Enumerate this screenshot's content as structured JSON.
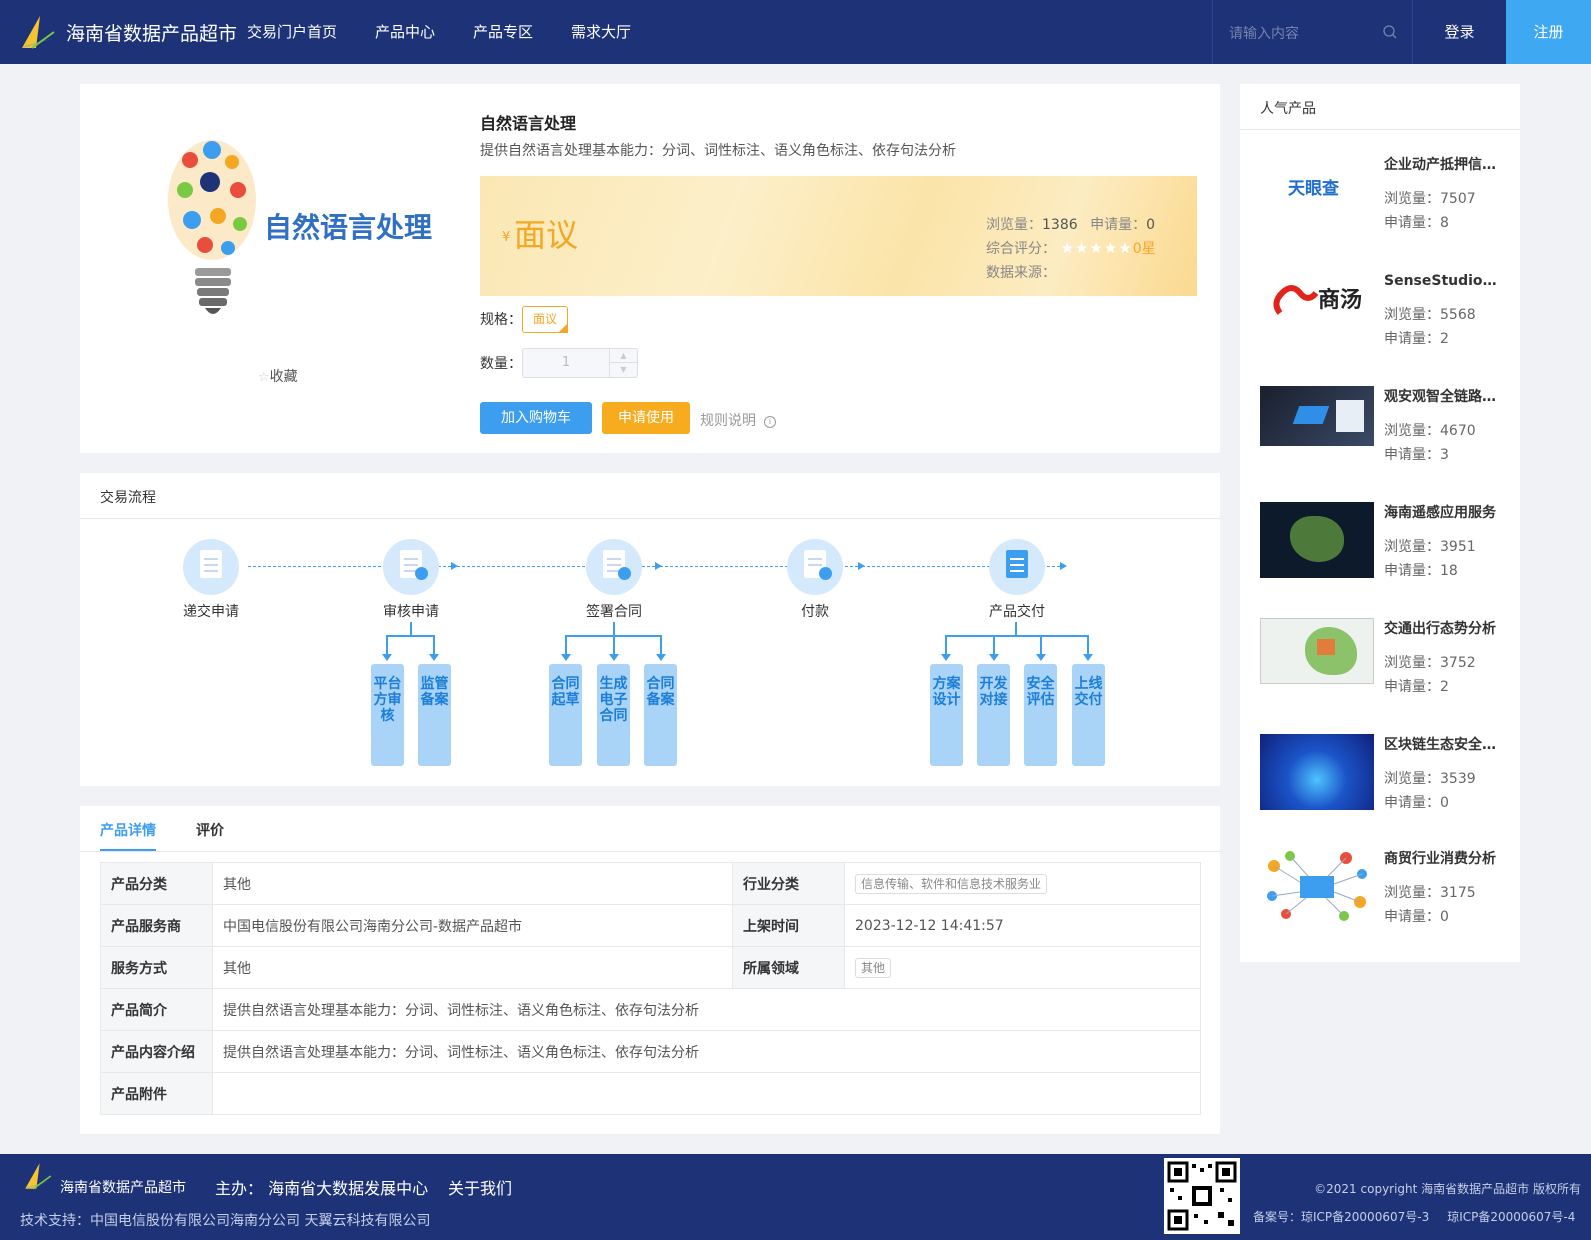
{
  "header": {
    "brand": "海南省数据产品超市",
    "nav": [
      "交易门户首页",
      "产品中心",
      "产品专区",
      "需求大厅"
    ],
    "search_placeholder": "请输入内容",
    "login": "登录",
    "register": "注册"
  },
  "product": {
    "title": "自然语言处理",
    "subtitle": "提供自然语言处理基本能力：分词、词性标注、语义角色标注、依存句法分析",
    "image_text": "自然语言处理",
    "collect": "收藏",
    "price_symbol": "¥",
    "price": "面议",
    "views_label": "浏览量：",
    "views": "1386",
    "applies_label": "申请量：",
    "applies": "0",
    "rating_label": "综合评分：",
    "rating_value": "0星",
    "source_label": "数据来源：",
    "spec_label": "规格：",
    "spec_value": "面议",
    "qty_label": "数量：",
    "qty_value": "1",
    "add_cart": "加入购物车",
    "apply": "申请使用",
    "rules": "规则说明"
  },
  "flow": {
    "title": "交易流程",
    "steps": [
      "递交申请",
      "审核申请",
      "签署合同",
      "付款",
      "产品交付"
    ],
    "review_subs": [
      "平台方审核",
      "监管备案"
    ],
    "contract_subs": [
      "合同起草",
      "生成电子合同",
      "合同备案"
    ],
    "delivery_subs": [
      "方案设计",
      "开发对接",
      "安全评估",
      "上线交付"
    ]
  },
  "detail": {
    "tabs": [
      "产品详情",
      "评价"
    ],
    "rows": {
      "category_k": "产品分类",
      "category_v": "其他",
      "industry_k": "行业分类",
      "industry_v": "信息传输、软件和信息技术服务业",
      "provider_k": "产品服务商",
      "provider_v": "中国电信股份有限公司海南分公司-数据产品超市",
      "online_k": "上架时间",
      "online_v": "2023-12-12 14:41:57",
      "service_k": "服务方式",
      "service_v": "其他",
      "domain_k": "所属领域",
      "domain_v": "其他",
      "intro_k": "产品简介",
      "intro_v": "提供自然语言处理基本能力：分词、词性标注、语义角色标注、依存句法分析",
      "content_k": "产品内容介绍",
      "content_v": "提供自然语言处理基本能力：分词、词性标注、语义角色标注、依存句法分析",
      "attach_k": "产品附件",
      "attach_v": ""
    }
  },
  "sidebar": {
    "title": "人气产品",
    "views_label": "浏览量：",
    "applies_label": "申请量：",
    "items": [
      {
        "name": "企业动产抵押信息查询",
        "views": "7507",
        "applies": "8",
        "img_text": "天眼查"
      },
      {
        "name": "SenseStudio人工智能开发平台",
        "views": "5568",
        "applies": "2",
        "img_text": "商汤"
      },
      {
        "name": "观安观智全链路数据安全",
        "views": "4670",
        "applies": "3",
        "img_text": ""
      },
      {
        "name": "海南遥感应用服务",
        "views": "3951",
        "applies": "18",
        "img_text": ""
      },
      {
        "name": "交通出行态势分析",
        "views": "3752",
        "applies": "2",
        "img_text": ""
      },
      {
        "name": "区块链生态安全服务",
        "views": "3539",
        "applies": "0",
        "img_text": ""
      },
      {
        "name": "商贸行业消费分析",
        "views": "3175",
        "applies": "0",
        "img_text": ""
      }
    ]
  },
  "footer": {
    "brand": "海南省数据产品超市",
    "host": "主办： 海南省大数据发展中心",
    "about": "关于我们",
    "support": "技术支持：中国电信股份有限公司海南分公司     天翼云科技有限公司",
    "copyright": "©2021 copyright 海南省数据产品超市 版权所有",
    "icp1": "备案号：琼ICP备20000607号-3",
    "icp2": "琼ICP备20000607号-4"
  },
  "colors": {
    "header_bg": "#1d3277",
    "accent_blue": "#3d9ef0",
    "accent_orange": "#f7ab1f",
    "register_bg": "#3fa8f2"
  }
}
